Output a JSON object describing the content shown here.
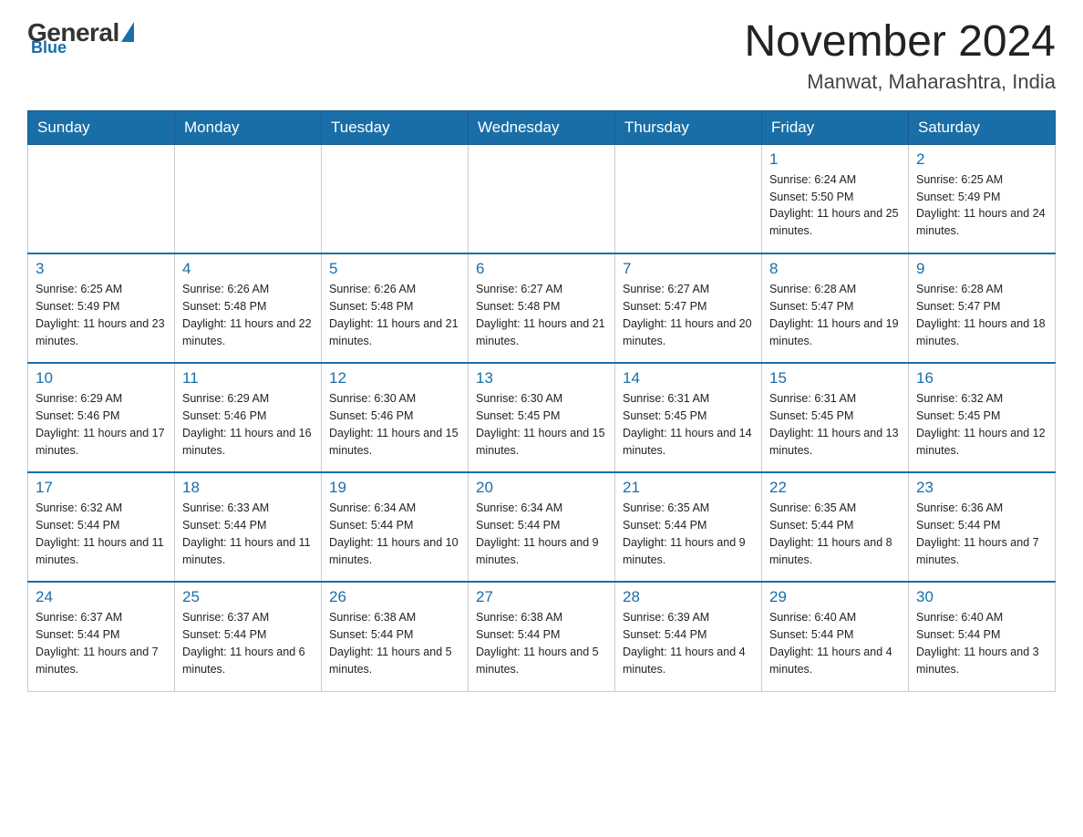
{
  "logo": {
    "general": "General",
    "blue": "Blue"
  },
  "header": {
    "title": "November 2024",
    "subtitle": "Manwat, Maharashtra, India"
  },
  "weekdays": [
    "Sunday",
    "Monday",
    "Tuesday",
    "Wednesday",
    "Thursday",
    "Friday",
    "Saturday"
  ],
  "weeks": [
    [
      {
        "day": "",
        "info": ""
      },
      {
        "day": "",
        "info": ""
      },
      {
        "day": "",
        "info": ""
      },
      {
        "day": "",
        "info": ""
      },
      {
        "day": "",
        "info": ""
      },
      {
        "day": "1",
        "info": "Sunrise: 6:24 AM\nSunset: 5:50 PM\nDaylight: 11 hours and 25 minutes."
      },
      {
        "day": "2",
        "info": "Sunrise: 6:25 AM\nSunset: 5:49 PM\nDaylight: 11 hours and 24 minutes."
      }
    ],
    [
      {
        "day": "3",
        "info": "Sunrise: 6:25 AM\nSunset: 5:49 PM\nDaylight: 11 hours and 23 minutes."
      },
      {
        "day": "4",
        "info": "Sunrise: 6:26 AM\nSunset: 5:48 PM\nDaylight: 11 hours and 22 minutes."
      },
      {
        "day": "5",
        "info": "Sunrise: 6:26 AM\nSunset: 5:48 PM\nDaylight: 11 hours and 21 minutes."
      },
      {
        "day": "6",
        "info": "Sunrise: 6:27 AM\nSunset: 5:48 PM\nDaylight: 11 hours and 21 minutes."
      },
      {
        "day": "7",
        "info": "Sunrise: 6:27 AM\nSunset: 5:47 PM\nDaylight: 11 hours and 20 minutes."
      },
      {
        "day": "8",
        "info": "Sunrise: 6:28 AM\nSunset: 5:47 PM\nDaylight: 11 hours and 19 minutes."
      },
      {
        "day": "9",
        "info": "Sunrise: 6:28 AM\nSunset: 5:47 PM\nDaylight: 11 hours and 18 minutes."
      }
    ],
    [
      {
        "day": "10",
        "info": "Sunrise: 6:29 AM\nSunset: 5:46 PM\nDaylight: 11 hours and 17 minutes."
      },
      {
        "day": "11",
        "info": "Sunrise: 6:29 AM\nSunset: 5:46 PM\nDaylight: 11 hours and 16 minutes."
      },
      {
        "day": "12",
        "info": "Sunrise: 6:30 AM\nSunset: 5:46 PM\nDaylight: 11 hours and 15 minutes."
      },
      {
        "day": "13",
        "info": "Sunrise: 6:30 AM\nSunset: 5:45 PM\nDaylight: 11 hours and 15 minutes."
      },
      {
        "day": "14",
        "info": "Sunrise: 6:31 AM\nSunset: 5:45 PM\nDaylight: 11 hours and 14 minutes."
      },
      {
        "day": "15",
        "info": "Sunrise: 6:31 AM\nSunset: 5:45 PM\nDaylight: 11 hours and 13 minutes."
      },
      {
        "day": "16",
        "info": "Sunrise: 6:32 AM\nSunset: 5:45 PM\nDaylight: 11 hours and 12 minutes."
      }
    ],
    [
      {
        "day": "17",
        "info": "Sunrise: 6:32 AM\nSunset: 5:44 PM\nDaylight: 11 hours and 11 minutes."
      },
      {
        "day": "18",
        "info": "Sunrise: 6:33 AM\nSunset: 5:44 PM\nDaylight: 11 hours and 11 minutes."
      },
      {
        "day": "19",
        "info": "Sunrise: 6:34 AM\nSunset: 5:44 PM\nDaylight: 11 hours and 10 minutes."
      },
      {
        "day": "20",
        "info": "Sunrise: 6:34 AM\nSunset: 5:44 PM\nDaylight: 11 hours and 9 minutes."
      },
      {
        "day": "21",
        "info": "Sunrise: 6:35 AM\nSunset: 5:44 PM\nDaylight: 11 hours and 9 minutes."
      },
      {
        "day": "22",
        "info": "Sunrise: 6:35 AM\nSunset: 5:44 PM\nDaylight: 11 hours and 8 minutes."
      },
      {
        "day": "23",
        "info": "Sunrise: 6:36 AM\nSunset: 5:44 PM\nDaylight: 11 hours and 7 minutes."
      }
    ],
    [
      {
        "day": "24",
        "info": "Sunrise: 6:37 AM\nSunset: 5:44 PM\nDaylight: 11 hours and 7 minutes."
      },
      {
        "day": "25",
        "info": "Sunrise: 6:37 AM\nSunset: 5:44 PM\nDaylight: 11 hours and 6 minutes."
      },
      {
        "day": "26",
        "info": "Sunrise: 6:38 AM\nSunset: 5:44 PM\nDaylight: 11 hours and 5 minutes."
      },
      {
        "day": "27",
        "info": "Sunrise: 6:38 AM\nSunset: 5:44 PM\nDaylight: 11 hours and 5 minutes."
      },
      {
        "day": "28",
        "info": "Sunrise: 6:39 AM\nSunset: 5:44 PM\nDaylight: 11 hours and 4 minutes."
      },
      {
        "day": "29",
        "info": "Sunrise: 6:40 AM\nSunset: 5:44 PM\nDaylight: 11 hours and 4 minutes."
      },
      {
        "day": "30",
        "info": "Sunrise: 6:40 AM\nSunset: 5:44 PM\nDaylight: 11 hours and 3 minutes."
      }
    ]
  ]
}
